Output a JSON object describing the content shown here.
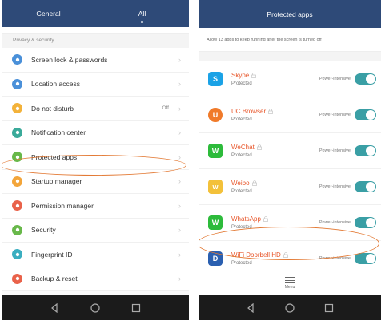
{
  "left": {
    "tabs": [
      "General",
      "All"
    ],
    "active_tab": "All",
    "section": "Privacy & security",
    "items": [
      {
        "label": "Screen lock & passwords",
        "value": "",
        "icon": "lock-icon",
        "color": "#4a90d9"
      },
      {
        "label": "Location access",
        "value": "",
        "icon": "location-icon",
        "color": "#4a90d9"
      },
      {
        "label": "Do not disturb",
        "value": "Off",
        "icon": "moon-icon",
        "color": "#f3b23a"
      },
      {
        "label": "Notification center",
        "value": "",
        "icon": "notification-icon",
        "color": "#3aaa9a"
      },
      {
        "label": "Protected apps",
        "value": "",
        "icon": "shield-icon",
        "color": "#68b84a"
      },
      {
        "label": "Startup manager",
        "value": "",
        "icon": "startup-icon",
        "color": "#f3a53a"
      },
      {
        "label": "Permission manager",
        "value": "",
        "icon": "key-icon",
        "color": "#e9624a"
      },
      {
        "label": "Security",
        "value": "",
        "icon": "security-icon",
        "color": "#68b84a"
      },
      {
        "label": "Fingerprint ID",
        "value": "",
        "icon": "fingerprint-icon",
        "color": "#3aaec0"
      },
      {
        "label": "Backup & reset",
        "value": "",
        "icon": "backup-icon",
        "color": "#e9624a"
      }
    ]
  },
  "right": {
    "title": "Protected apps",
    "description": "Allow 13 apps to keep running after the screen is turned off",
    "apps": [
      {
        "name": "Skype",
        "status": "Protected",
        "tag": "Power-intensive",
        "icon": "skype-icon",
        "color": "#1aa2e6",
        "glyph": "S",
        "enabled": true
      },
      {
        "name": "UC Browser",
        "status": "Protected",
        "tag": "Power-intensive",
        "icon": "uc-browser-icon",
        "color": "#f07a2a",
        "glyph": "U",
        "enabled": true
      },
      {
        "name": "WeChat",
        "status": "Protected",
        "tag": "Power-intensive",
        "icon": "wechat-icon",
        "color": "#2dbb3b",
        "glyph": "W",
        "enabled": true
      },
      {
        "name": "Weibo",
        "status": "Protected",
        "tag": "Power-intensive",
        "icon": "weibo-icon",
        "color": "#f3c13a",
        "glyph": "w",
        "enabled": true
      },
      {
        "name": "WhatsApp",
        "status": "Protected",
        "tag": "Power-intensive",
        "icon": "whatsapp-icon",
        "color": "#2dbb3b",
        "glyph": "W",
        "enabled": true
      },
      {
        "name": "WiFi Doorbell HD",
        "status": "Protected",
        "tag": "Power-intensive",
        "icon": "doorbell-icon",
        "color": "#2a5fb0",
        "glyph": "D",
        "enabled": true
      }
    ],
    "menu_label": "Menu"
  },
  "accent_color": "#3a9fa5",
  "header_color": "#2e4a78",
  "highlight_color": "#e37a35"
}
